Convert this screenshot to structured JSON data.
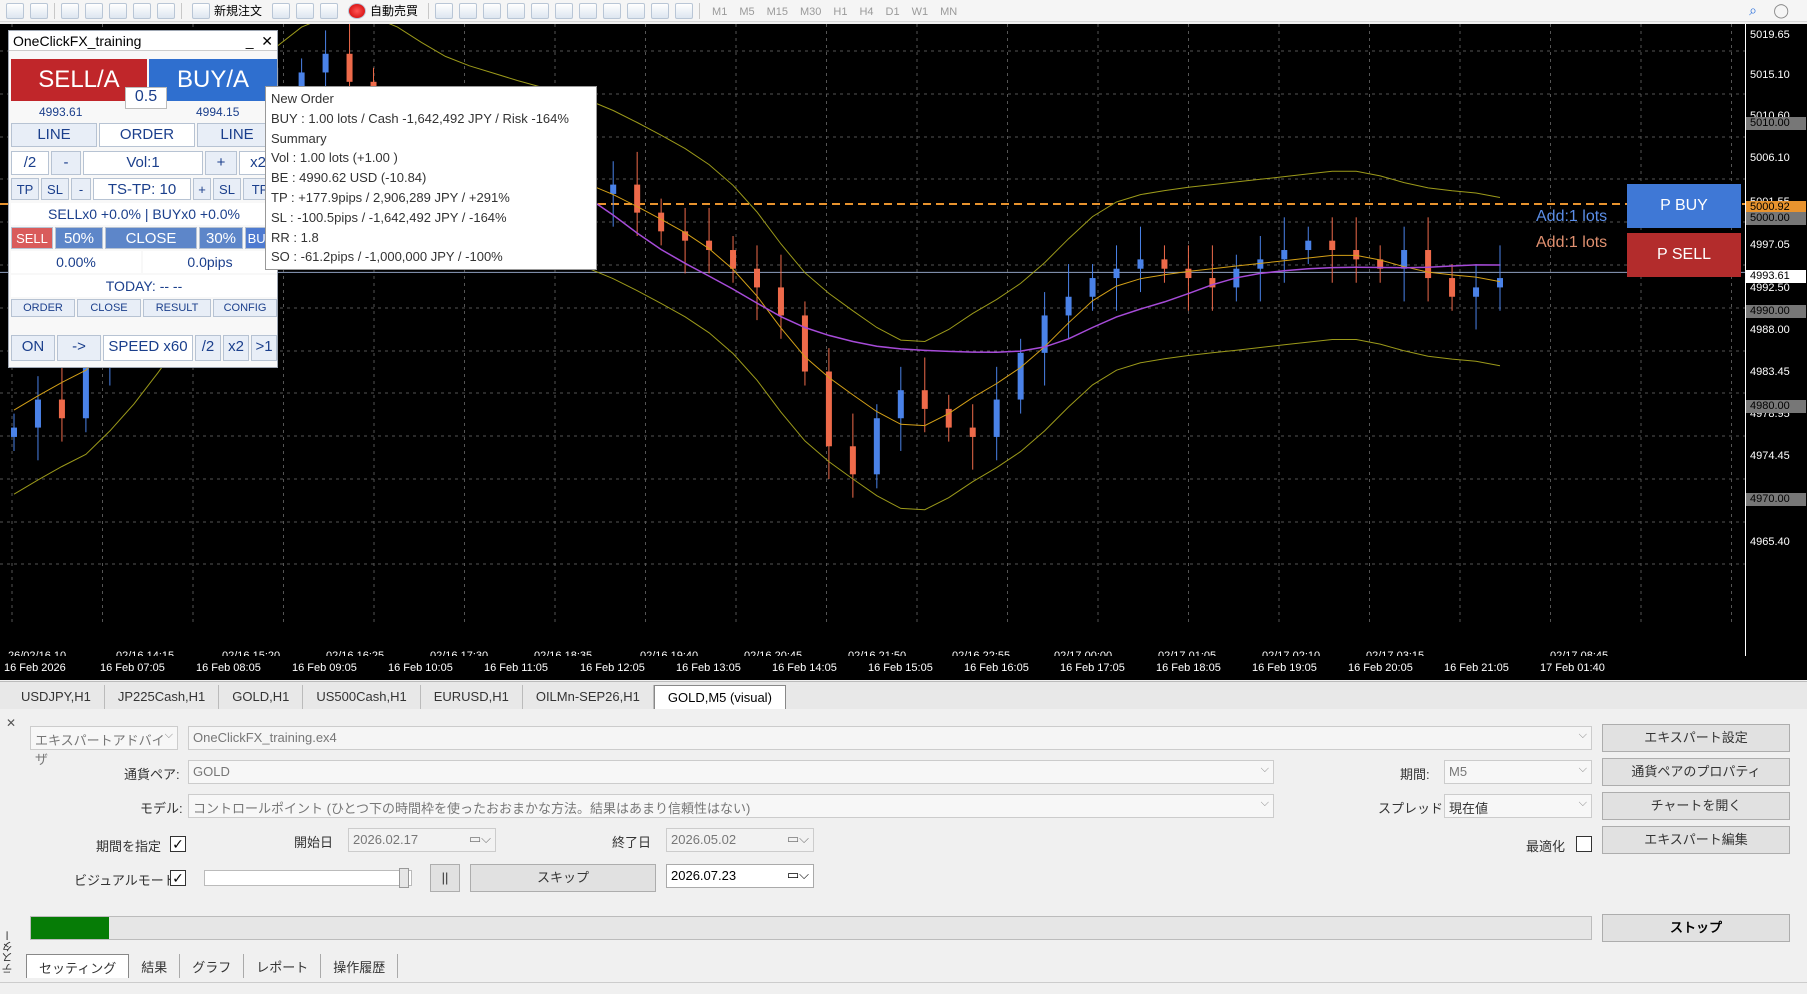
{
  "toolbar": {
    "new_order": "新規注文",
    "auto_trade": "自動売買",
    "timeframes": [
      "M1",
      "M5",
      "M15",
      "M30",
      "H1",
      "H4",
      "D1",
      "W1",
      "MN"
    ]
  },
  "ocp": {
    "title": "OneClickFX_training",
    "sell_label": "SELL/A",
    "buy_label": "BUY/A",
    "lot": "0.5",
    "sell_price": "4993.61",
    "buy_price": "4994.15",
    "row_line_left": "LINE",
    "row_order": "ORDER",
    "row_line_right": "LINE",
    "div2": "/2",
    "minus": "-",
    "vol": "Vol:1",
    "plus": "+",
    "x2": "x2",
    "tp": "TP",
    "sl": "SL",
    "tstp_minus": "-",
    "tstp": "TS-TP: 10",
    "tstp_plus": "+",
    "sl2": "SL",
    "tp2": "TP",
    "position_summary": "SELLx0 +0.0%  |  BUYx0 +0.0%",
    "close_sell": "SELL",
    "close_50": "50%",
    "close": "CLOSE",
    "close_30": "30%",
    "close_buy": "BUY",
    "pct": "0.00%",
    "pips": "0.0pips",
    "today": "TODAY: -- --",
    "tab_order": "ORDER",
    "tab_close": "CLOSE",
    "tab_result": "RESULT",
    "tab_config": "CONFIG",
    "on": "ON",
    "arrow": "->",
    "speed": "SPEED x60",
    "sdiv2": "/2",
    "sx2": "x2",
    "sgt1": ">1"
  },
  "tooltip": {
    "lines": [
      "New Order",
      "BUY : 1.00 lots / Cash -1,642,492 JPY / Risk -164%",
      "Summary",
      "Vol : 1.00 lots (+1.00 )",
      "BE : 4990.62 USD (-10.84)",
      "TP : +177.9pips / 2,906,289 JPY / +291%",
      "SL : -100.5pips / -1,642,492 JPY / -164%",
      "RR : 1.8",
      "SO : -61.2pips / -1,000,000 JPY / -100%"
    ]
  },
  "pbuy": "P BUY",
  "psell": "P SELL",
  "add_buy": "Add:1 lots",
  "add_sell": "Add:1 lots",
  "price_axis": {
    "ticks": [
      "5019.65",
      "5015.10",
      "5010.60",
      "5006.10",
      "5001.55",
      "4997.05",
      "4992.50",
      "4988.00",
      "4983.45",
      "4978.95",
      "4974.45",
      "4969.90",
      "4965.40"
    ],
    "boxes": [
      {
        "label": "5010.00",
        "kind": "gray"
      },
      {
        "label": "5000.92",
        "kind": "orange"
      },
      {
        "label": "5000.00",
        "kind": "gray"
      },
      {
        "label": "4993.61",
        "kind": "white"
      },
      {
        "label": "4990.00",
        "kind": "gray"
      },
      {
        "label": "4980.00",
        "kind": "gray"
      },
      {
        "label": "4970.00",
        "kind": "gray"
      }
    ]
  },
  "time_axis": [
    "26/02/16 10",
    "02/16 14:15",
    "02/16 15:20",
    "02/16 16:25",
    "02/16 17:30",
    "02/16 18:35",
    "02/16 19:40",
    "02/16 20:45",
    "02/16 21:50",
    "02/16 22:55",
    "02/17 00:00",
    "02/17 01:05",
    "02/17 02:10",
    "02/17 03:15",
    "02/17 08:45"
  ],
  "date_axis": [
    "16 Feb 2026",
    "16 Feb 07:05",
    "16 Feb 08:05",
    "16 Feb 09:05",
    "16 Feb 10:05",
    "16 Feb 11:05",
    "16 Feb 12:05",
    "16 Feb 13:05",
    "16 Feb 14:05",
    "16 Feb 15:05",
    "16 Feb 16:05",
    "16 Feb 17:05",
    "16 Feb 18:05",
    "16 Feb 19:05",
    "16 Feb 20:05",
    "16 Feb 21:05",
    "17 Feb 01:40"
  ],
  "chart_tabs": [
    "USDJPY,H1",
    "JP225Cash,H1",
    "GOLD,H1",
    "US500Cash,H1",
    "EURUSD,H1",
    "OILMn-SEP26,H1",
    "GOLD,M5 (visual)"
  ],
  "colors": {
    "bull": "#4a82e8",
    "bear": "#ee6a4a",
    "bands": "#9c9a1a",
    "ma_mid": "#d4a017",
    "ma_slow": "#a64bd8",
    "orange_line": "#e8932e"
  },
  "tester": {
    "type": "エキスパートアドバイザ",
    "ea": "OneClickFX_training.ex4",
    "btn_expert_settings": "エキスパート設定",
    "symbol_label": "通貨ペア:",
    "symbol": "GOLD",
    "period_label": "期間:",
    "period": "M5",
    "btn_symbol_props": "通貨ペアのプロパティ",
    "model_label": "モデル:",
    "model": "コントロールポイント (ひとつ下の時間枠を使ったおおまかな方法。結果はあまり信頼性はない)",
    "spread_label": "スプレッド:",
    "spread": "現在値",
    "btn_open_chart": "チャートを開く",
    "use_date_label": "期間を指定",
    "start_label": "開始日",
    "start_date": "2026.02.17",
    "end_label": "終了日",
    "end_date": "2026.05.02",
    "optimize_label": "最適化",
    "btn_edit_expert": "エキスパート編集",
    "visual_label": "ビジュアルモード",
    "pause": "||",
    "skip": "スキップ",
    "skip_date": "2026.07.23",
    "stop": "ストップ",
    "progress": 0.05,
    "tabs": [
      "セッティング",
      "結果",
      "グラフ",
      "レポート",
      "操作履歴"
    ],
    "vertical": "テスター"
  }
}
